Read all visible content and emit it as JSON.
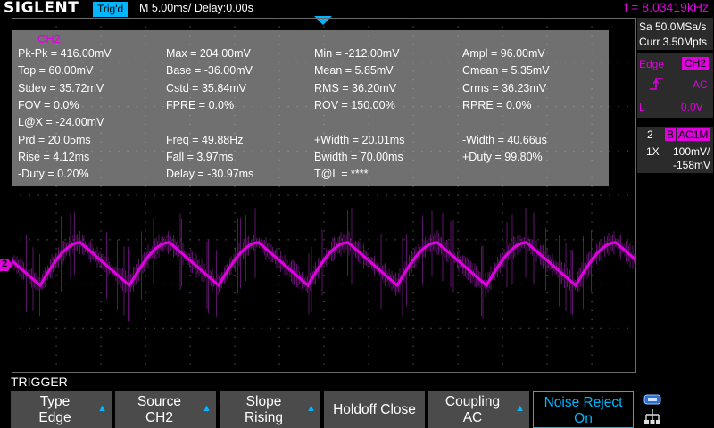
{
  "header": {
    "logo": "SIGLENT",
    "trigger_status": "Trig'd",
    "timebase": "M 5.00ms/ Delay:0.00s",
    "frequency": "f = 8.03419kHz"
  },
  "measurements": {
    "channel": "CH2",
    "rows": [
      [
        "Pk-Pk = 416.00mV",
        "Max = 204.00mV",
        "Min = -212.00mV",
        "Ampl = 96.00mV"
      ],
      [
        "Top = 60.00mV",
        "Base = -36.00mV",
        "Mean = 5.85mV",
        "Cmean = 5.35mV"
      ],
      [
        "Stdev = 35.72mV",
        "Cstd = 35.84mV",
        "RMS = 36.20mV",
        "Crms = 36.23mV"
      ],
      [
        "FOV = 0.0%",
        "FPRE = 0.0%",
        "ROV = 150.00%",
        "RPRE = 0.0%"
      ],
      [
        "L@X = -24.00mV",
        "",
        "",
        ""
      ],
      [
        "Prd = 20.05ms",
        "Freq = 49.88Hz",
        "+Width = 20.01ms",
        "-Width = 40.66us"
      ],
      [
        "Rise = 4.12ms",
        "Fall = 3.97ms",
        "Bwidth = 70.00ms",
        "+Duty = 99.80%"
      ],
      [
        "-Duty = 0.20%",
        "Delay = -30.97ms",
        "T@L = ****",
        ""
      ]
    ]
  },
  "acquisition": {
    "sample_rate": "Sa 50.0MSa/s",
    "memory": "Curr 3.50Mpts"
  },
  "trigger_panel": {
    "type_label": "Edge",
    "source": "CH2",
    "slope_icon": "rising-edge-icon",
    "coupling": "AC",
    "level_label": "L",
    "level_value": "0.0V"
  },
  "channel_panel": {
    "number": "2",
    "bw_flag": "B",
    "coupling": "AC1M",
    "probe": "1X",
    "scale": "100mV/",
    "offset": "-158mV"
  },
  "channel_marker": "2",
  "trigger_title": "TRIGGER",
  "menu": {
    "type": {
      "l1": "Type",
      "l2": "Edge"
    },
    "source": {
      "l1": "Source",
      "l2": "CH2"
    },
    "slope": {
      "l1": "Slope",
      "l2": "Rising"
    },
    "holdoff": {
      "label": "Holdoff Close"
    },
    "coupling": {
      "l1": "Coupling",
      "l2": "AC"
    },
    "noise_reject": {
      "l1": "Noise Reject",
      "l2": "On"
    }
  },
  "colors": {
    "ch2": "#e000e0",
    "accent": "#00b7ff",
    "grid": "#5a5a5a",
    "menu_bg": "#4b4b4b"
  },
  "waveform": {
    "period_ms": 20.05,
    "visible_cycles": 7
  }
}
